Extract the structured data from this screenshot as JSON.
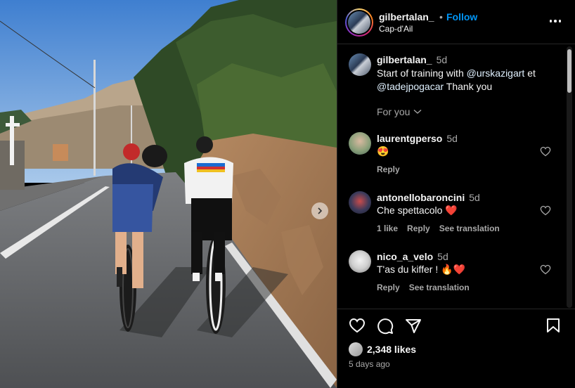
{
  "post": {
    "username": "gilbertalan_",
    "dot": "•",
    "follow_label": "Follow",
    "location": "Cap-d'Ail"
  },
  "caption": {
    "username": "gilbertalan_",
    "time": "5d",
    "text_start": "Start of training with ",
    "mention1": "@urskazigart",
    "text_mid": " et ",
    "mention2": "@tadejpogacar",
    "text_end": " Thank you",
    "for_you_label": "For you"
  },
  "comments": [
    {
      "username": "laurentgperso",
      "time": "5d",
      "text": "😍",
      "actions": [
        "Reply"
      ]
    },
    {
      "username": "antonellobaroncini",
      "time": "5d",
      "text": "Che spettacolo ❤️",
      "actions": [
        "1 like",
        "Reply",
        "See translation"
      ]
    },
    {
      "username": "nico_a_velo",
      "time": "5d",
      "text": "T'as du kiffer ! 🔥❤️",
      "actions": [
        "Reply",
        "See translation"
      ]
    }
  ],
  "footer": {
    "likes": "2,348 likes",
    "date": "5 days ago"
  },
  "icons": {
    "more": "more-horizontal-icon",
    "like": "heart-icon",
    "comment": "comment-bubble-icon",
    "share": "paper-plane-icon",
    "save": "bookmark-icon",
    "next": "chevron-right-icon"
  },
  "colors": {
    "follow": "#0095f6",
    "secondary_text": "#a8a8a8",
    "background": "#000000"
  }
}
